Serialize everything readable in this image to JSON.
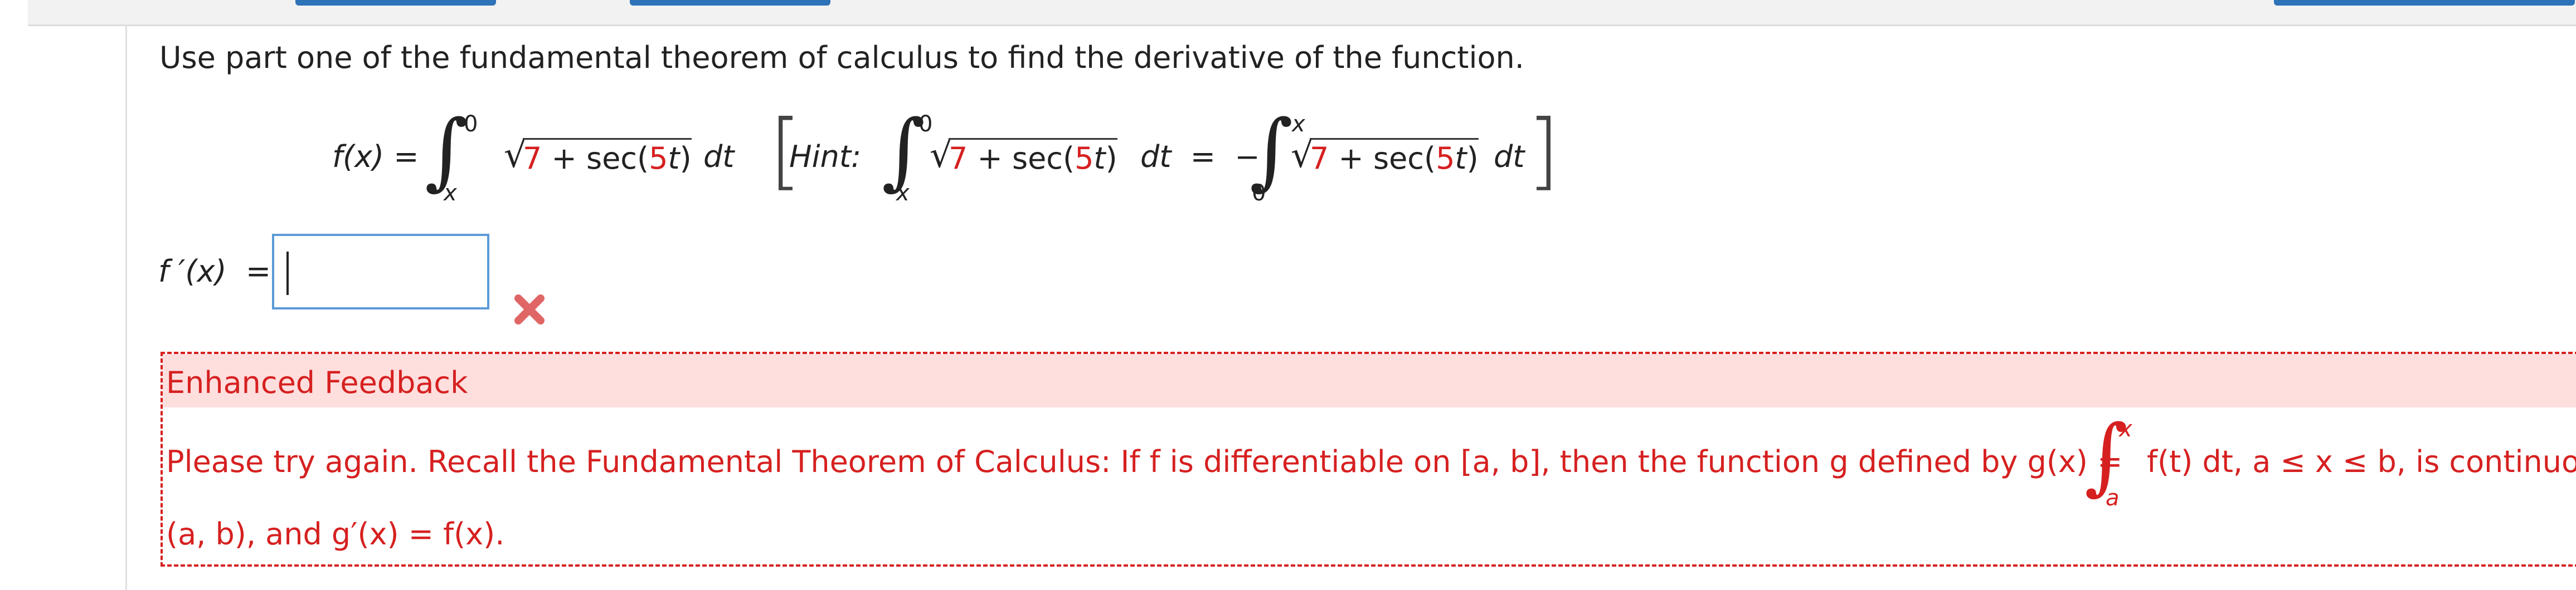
{
  "question": {
    "prompt": "Use part one of the fundamental theorem of calculus to find the derivative of the function."
  },
  "function": {
    "lhs": "f(x) =",
    "upper": "0",
    "lower": "x",
    "const": "7",
    "plus": "+ sec(",
    "coef": "5",
    "var": "t",
    "close": ")",
    "dt": "dt"
  },
  "hint": {
    "label": "Hint:",
    "upper1": "0",
    "lower1": "x",
    "eqminus": "dt  =  −",
    "upper2": "x",
    "lower2": "0",
    "dt": "dt"
  },
  "answer": {
    "label": "f ′(x)  =",
    "value": "",
    "status": "incorrect"
  },
  "feedback": {
    "title": "Enhanced Feedback",
    "line1_before": "Please try again. Recall the Fundamental Theorem of Calculus: If f is differentiable on [a, b], then the function g defined by g(x)  =",
    "integral_upper": "x",
    "integral_lower": "a",
    "line1_after": "f(t) dt, a ≤ x ≤ b, is continuou",
    "line2": "(a, b), and g′(x)  =  f(x)."
  },
  "colors": {
    "accent_red": "#d62020",
    "input_border": "#5a9bd8",
    "feedback_band": "#ffdede"
  }
}
